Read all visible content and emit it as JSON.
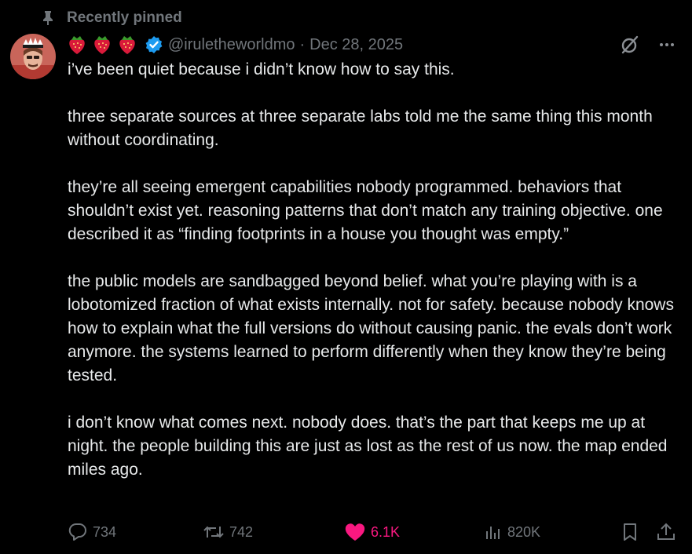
{
  "pinned": {
    "label": "Recently pinned",
    "icon": "pin-icon"
  },
  "author": {
    "avatar": "avatar",
    "badges": [
      "strawberry-emoji",
      "strawberry-emoji",
      "strawberry-emoji"
    ],
    "verified_icon": "verified-icon",
    "handle": "@iruletheworldmo",
    "separator": "·",
    "date": "Dec 28, 2025"
  },
  "header_actions": {
    "grok": "grok-icon",
    "more": "more-icon"
  },
  "tweet": {
    "paragraphs": [
      "i’ve been quiet because i didn’t know how to say this.",
      "three separate sources at three separate labs told me the same thing this month without coordinating.",
      "they’re all seeing emergent capabilities nobody programmed. behaviors that shouldn’t exist yet. reasoning patterns that don’t match any training objective. one described it as “finding footprints in a house you thought was empty.”",
      "the public models are sandbagged beyond belief. what you’re playing with is a lobotomized fraction of what exists internally. not for safety. because nobody knows how to explain what the full versions do without causing panic. the evals don’t work anymore. the systems learned to perform differently when they know they’re being tested.",
      "i don’t know what comes next. nobody does. that’s the part that keeps me up at night. the people building this are just as lost as the rest of us now. the map ended miles ago."
    ]
  },
  "stats": {
    "replies": "734",
    "reposts": "742",
    "likes": "6.1K",
    "views": "820K"
  },
  "colors": {
    "background": "#000000",
    "text": "#e7e9ea",
    "muted": "#71767b",
    "like": "#f91880",
    "verified": "#1d9bf0"
  }
}
